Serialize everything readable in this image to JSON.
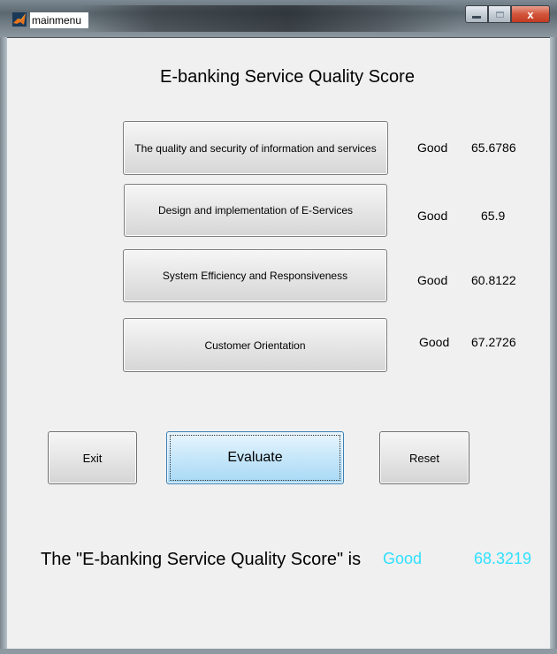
{
  "window": {
    "title": "mainmenu",
    "close_glyph": "x"
  },
  "heading": "E-banking Service Quality Score",
  "criteria": [
    {
      "label": "The quality and security of information and services",
      "rating": "Good",
      "score": "65.6786"
    },
    {
      "label": "Design and implementation of E-Services",
      "rating": "Good",
      "score": "65.9"
    },
    {
      "label": "System Efficiency and Responsiveness",
      "rating": "Good",
      "score": "60.8122"
    },
    {
      "label": "Customer Orientation",
      "rating": "Good",
      "score": "67.2726"
    }
  ],
  "actions": {
    "exit_label": "Exit",
    "evaluate_label": "Evaluate",
    "reset_label": "Reset"
  },
  "result": {
    "label": "The \"E-banking Service Quality Score\" is",
    "rating": "Good",
    "score": "68.3219",
    "color": "#2fe0ff"
  },
  "icons": {
    "app": "matlab-icon",
    "minimize": "minimize-icon",
    "maximize": "maximize-icon",
    "close": "close-icon"
  }
}
